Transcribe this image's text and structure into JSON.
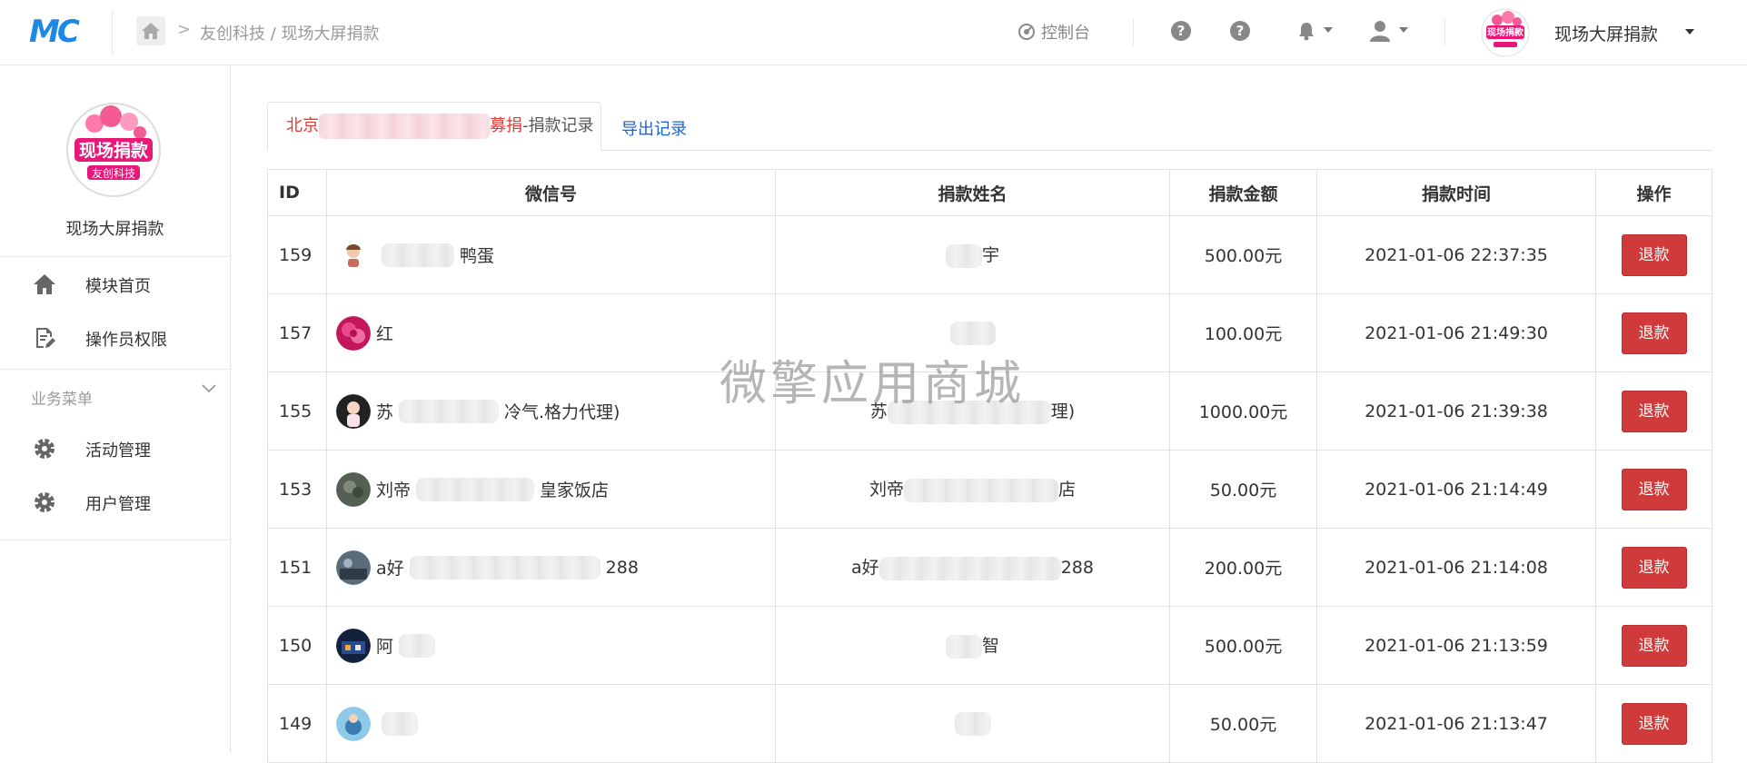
{
  "header": {
    "logo_text": "MC",
    "breadcrumb_sep": ">",
    "breadcrumb": "友创科技 / 现场大屏捐款",
    "console_label": "控制台",
    "help_glyph": "?",
    "brand_name": "现场大屏捐款",
    "brand_logo_text": "现场捐款"
  },
  "sidebar": {
    "logo_text": "现场捐款",
    "logo_sub": "友创科技",
    "name": "现场大屏捐款",
    "items": [
      {
        "label": "模块首页",
        "icon": "home-icon"
      },
      {
        "label": "操作员权限",
        "icon": "document-edit-icon"
      }
    ],
    "section_title": "业务菜单",
    "section_items": [
      {
        "label": "活动管理",
        "icon": "gear-icon"
      },
      {
        "label": "用户管理",
        "icon": "gear-icon"
      }
    ]
  },
  "tabs": {
    "active_prefix": "北京",
    "active_mid": "募捐",
    "active_suffix": "-捐款记录",
    "export_label": "导出记录"
  },
  "table": {
    "headers": [
      "ID",
      "微信号",
      "捐款姓名",
      "捐款金额",
      "捐款时间",
      "操作"
    ],
    "refund_label": "退款",
    "rows": [
      {
        "id": "159",
        "wx_a": "",
        "wx_b": "鸭蛋",
        "name_a": "",
        "name_b": "宇",
        "amount": "500.00元",
        "time": "2021-01-06 22:37:35"
      },
      {
        "id": "157",
        "wx_a": "红",
        "wx_b": "",
        "name_a": "",
        "name_b": "",
        "amount": "100.00元",
        "time": "2021-01-06 21:49:30"
      },
      {
        "id": "155",
        "wx_a": "苏",
        "wx_b": "冷气.格力代理)",
        "name_a": "苏",
        "name_b": "理)",
        "amount": "1000.00元",
        "time": "2021-01-06 21:39:38"
      },
      {
        "id": "153",
        "wx_a": "刘帝",
        "wx_b": "皇家饭店",
        "name_a": "刘帝",
        "name_b": "店",
        "amount": "50.00元",
        "time": "2021-01-06 21:14:49"
      },
      {
        "id": "151",
        "wx_a": "a好",
        "wx_b": "288",
        "name_a": "a好",
        "name_b": "288",
        "amount": "200.00元",
        "time": "2021-01-06 21:14:08"
      },
      {
        "id": "150",
        "wx_a": "阿",
        "wx_b": "",
        "name_a": "",
        "name_b": "智",
        "amount": "500.00元",
        "time": "2021-01-06 21:13:59"
      },
      {
        "id": "149",
        "wx_a": "",
        "wx_b": "",
        "name_a": "",
        "name_b": "",
        "amount": "50.00元",
        "time": "2021-01-06 21:13:47"
      }
    ]
  },
  "watermark": "微擎应用商城",
  "colors": {
    "accent_blue": "#1e88e5",
    "refund_red": "#d03a3a",
    "tab_red": "#e53935",
    "link_blue": "#1e63d6"
  }
}
